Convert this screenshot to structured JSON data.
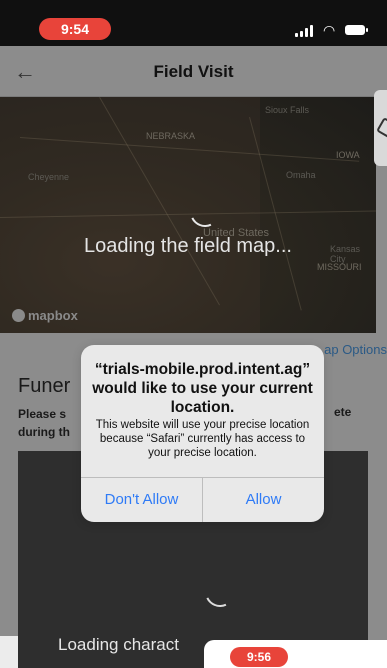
{
  "status_bar": {
    "time": "9:54",
    "time_color": "#e8443a",
    "icons": [
      "signal-icon",
      "wifi-icon",
      "battery-icon"
    ]
  },
  "nav": {
    "title": "Field Visit",
    "back_icon": "back-arrow-icon"
  },
  "map": {
    "loading_text": "Loading the field map...",
    "attribution": "mapbox",
    "labels": [
      "Sioux Falls",
      "IOWA",
      "Omaha",
      "Cheyenne",
      "United States",
      "Kansas City",
      "MISSOURI",
      "NEBRASKA"
    ]
  },
  "body": {
    "map_options": "ap Options",
    "section_title": "Funer",
    "section_desc_line1": "Please s",
    "section_desc_line2": "during th",
    "section_desc_right": "ete",
    "characteristics_loading": "Loading charact"
  },
  "alert": {
    "title": "“trials-mobile.prod.intent.ag” would like to use your current location.",
    "message": "This website will use your precise location because “Safari” currently has access to your precise location.",
    "deny_label": "Don't Allow",
    "allow_label": "Allow",
    "button_color": "#2f7bf6"
  },
  "peek": {
    "time": "9:56"
  }
}
